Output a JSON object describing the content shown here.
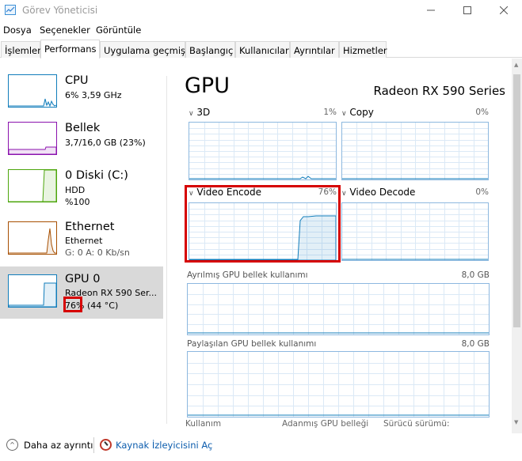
{
  "window": {
    "title": "Görev Yöneticisi"
  },
  "menu": [
    "Dosya",
    "Seçenekler",
    "Görüntüle"
  ],
  "tabs": [
    "İşlemler",
    "Performans",
    "Uygulama geçmişi",
    "Başlangıç",
    "Kullanıcılar",
    "Ayrıntılar",
    "Hizmetler"
  ],
  "left": {
    "cpu": {
      "name": "CPU",
      "sub": "6% 3,59 GHz"
    },
    "mem": {
      "name": "Bellek",
      "sub": "3,7/16,0 GB (23%)"
    },
    "disk": {
      "name": "0 Diski (C:)",
      "sub1": "HDD",
      "sub2": "%100"
    },
    "eth": {
      "name": "Ethernet",
      "sub1": "Ethernet",
      "sub2": "G: 0 A: 0 Kb/sn"
    },
    "gpu": {
      "name": "GPU 0",
      "sub1": "Radeon RX 590 Ser...",
      "pct": "76%",
      "temp": "(44 °C)"
    }
  },
  "main": {
    "title": "GPU",
    "model": "Radeon RX 590 Series",
    "engines": [
      {
        "label": "3D",
        "pct": "1%"
      },
      {
        "label": "Copy",
        "pct": "0%"
      },
      {
        "label": "Video Encode",
        "pct": "76%"
      },
      {
        "label": "Video Decode",
        "pct": "0%"
      }
    ],
    "dedicated": {
      "label": "Ayrılmış GPU bellek kullanımı",
      "value": "8,0 GB"
    },
    "shared": {
      "label": "Paylaşılan GPU bellek kullanımı",
      "value": "8,0 GB"
    },
    "bottom": [
      "Kullanım",
      "Adanmış GPU belleği",
      "Sürücü sürümü:"
    ]
  },
  "footer": {
    "less": "Daha az ayrıntı",
    "monitor": "Kaynak İzleyicisini Aç"
  },
  "colors": {
    "cpu": "#117dbb",
    "mem": "#8b12ae",
    "disk": "#4da60c",
    "eth": "#a74f01",
    "gpu": "#117dbb",
    "highlight": "#d60000"
  }
}
